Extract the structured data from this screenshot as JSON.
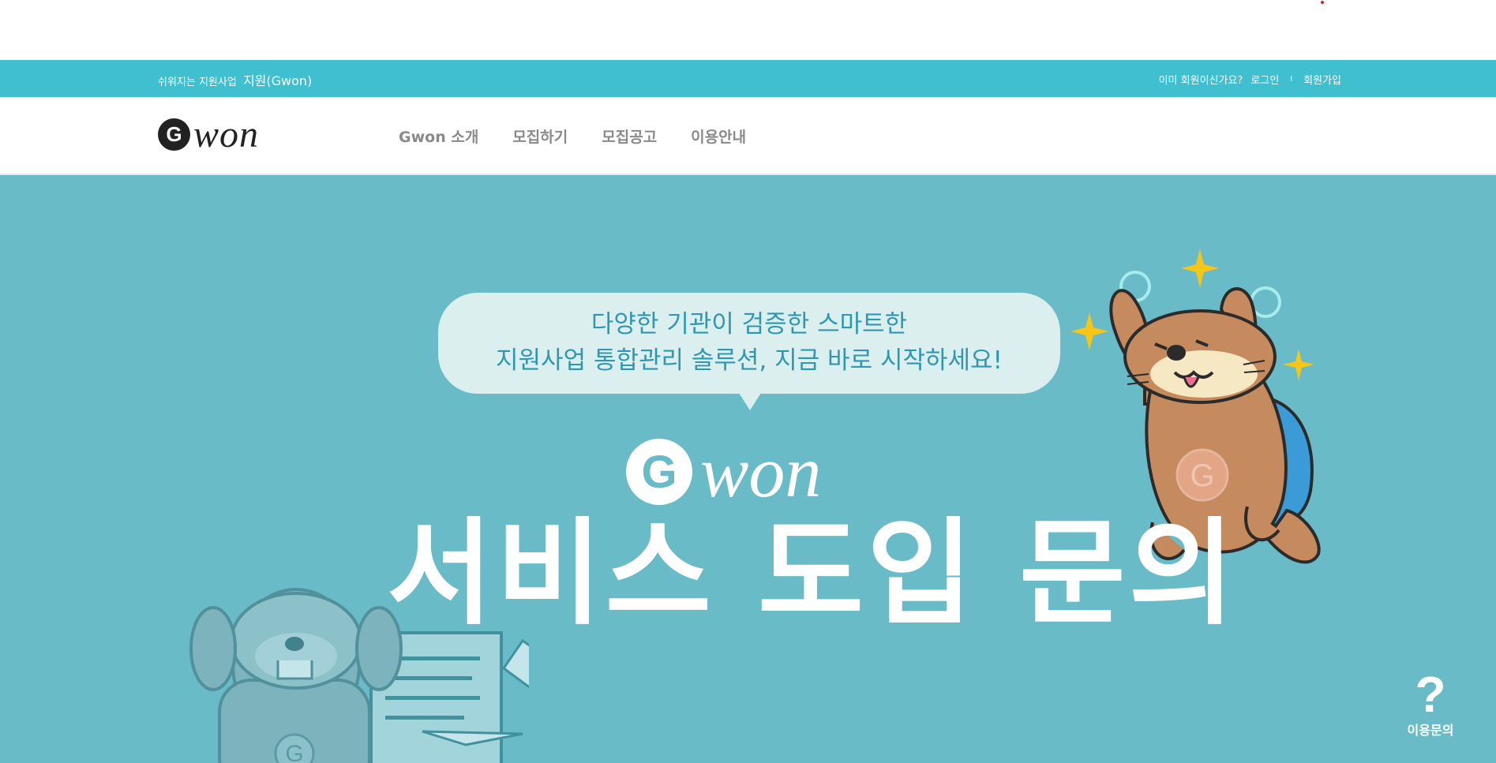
{
  "topbar": {
    "tagline": "쉬워지는 지원사업",
    "brand": "지원(Gwon)",
    "member_question": "이미 회원이신가요?",
    "login": "로그인",
    "separator": "I",
    "signup": "회원가입"
  },
  "header": {
    "logo_letter": "G",
    "logo_word": "won",
    "menu": [
      {
        "label": "Gwon 소개"
      },
      {
        "label": "모집하기"
      },
      {
        "label": "모집공고"
      },
      {
        "label": "이용안내"
      }
    ]
  },
  "hero": {
    "bubble_line1": "다양한 기관이 검증한 스마트한",
    "bubble_line2": "지원사업 통합관리 솔루션, 지금 바로 시작하세요!",
    "logo_letter": "G",
    "logo_word": "won",
    "title": "서비스 도입 문의"
  },
  "help": {
    "icon": "?",
    "label": "이용문의"
  },
  "colors": {
    "topbar": "#3fbfcf",
    "hero_bg": "#69bbc8",
    "bubble": "#dcefef",
    "bubble_text": "#2e97b2",
    "menu_text": "#8a8a8a",
    "sparkle": "#f5c518"
  }
}
